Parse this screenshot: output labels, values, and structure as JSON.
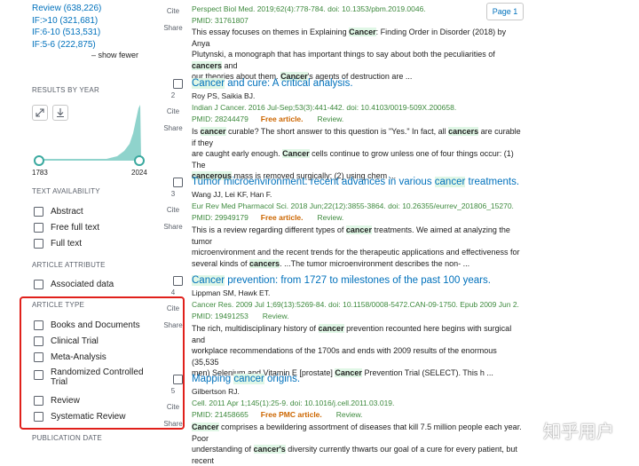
{
  "sidebar": {
    "top_links": [
      "Review (638,226)",
      "IF:>10 (321,681)",
      "IF:6-10 (513,531)",
      "IF:5-6 (222,875)"
    ],
    "show_fewer": "show fewer",
    "results_by_year": "RESULTS BY YEAR",
    "year_start": "1783",
    "year_end": "2024",
    "text_availability": {
      "heading": "TEXT AVAILABILITY",
      "items": [
        "Abstract",
        "Free full text",
        "Full text"
      ]
    },
    "article_attribute": {
      "heading": "ARTICLE ATTRIBUTE",
      "items": [
        "Associated data"
      ]
    },
    "article_type": {
      "heading": "ARTICLE TYPE",
      "items": [
        "Books and Documents",
        "Clinical Trial",
        "Meta-Analysis",
        "Randomized Controlled",
        "Trial",
        "Review",
        "Systematic Review"
      ]
    },
    "publication_date": "PUBLICATION DATE"
  },
  "page_button": "Page 1",
  "actions": {
    "cite": "Cite",
    "share": "Share"
  },
  "results": [
    {
      "journal": "Perspect Biol Med. 2019;62(4):778-784. doi: 10.1353/pbm.2019.0046.",
      "pmid": "PMID: 31761807",
      "snippet": [
        "This essay focuses on themes in Explaining ",
        "Cancer",
        ": Finding Order in Disorder (2018) by Anya",
        "Plutynski, a monograph that has important things to say about both the peculiarities of ",
        "cancers",
        " and",
        "our theories about them. ",
        "Cancer",
        "'s agents of destruction are ..."
      ]
    },
    {
      "number": "2",
      "title": [
        "Cancer",
        " and cure: A critical analysis."
      ],
      "authors": "Roy PS, Saikia BJ.",
      "journal": "Indian J Cancer. 2016 Jul-Sep;53(3):441-442. doi: 10.4103/0019-509X.200658.",
      "pmid": "PMID: 28244479",
      "badge": "Free article.",
      "type": "Review.",
      "snippet": [
        "Is ",
        "cancer",
        " curable? The short answer to this question is \"Yes.\" In fact, all ",
        "cancers",
        " are curable if they",
        "are caught early enough. ",
        "Cancer",
        " cells continue to grow unless one of four things occur: (1) The",
        "cancerous",
        " mass is removed surgically; (2) using chem ..."
      ]
    },
    {
      "number": "3",
      "title": [
        "Tumor microenvironment: recent advances in various ",
        "cancer",
        " treatments."
      ],
      "authors": "Wang JJ, Lei KF, Han F.",
      "journal": "Eur Rev Med Pharmacol Sci. 2018 Jun;22(12):3855-3864. doi: 10.26355/eurrev_201806_15270.",
      "pmid": "PMID: 29949179",
      "badge": "Free article.",
      "type": "Review.",
      "snippet": [
        "This is a review regarding different types of ",
        "cancer",
        " treatments. We aimed at analyzing the tumor",
        "microenvironment and the recent trends for the therapeutic applications and effectiveness for",
        "several kinds of ",
        "cancers",
        ". ...The tumor microenvironment describes the non- ..."
      ]
    },
    {
      "number": "4",
      "title": [
        "Cancer",
        " prevention: from 1727 to milestones of the past 100 years."
      ],
      "authors": "Lippman SM, Hawk ET.",
      "journal": "Cancer Res. 2009 Jul 1;69(13):5269-84. doi: 10.1158/0008-5472.CAN-09-1750. Epub 2009 Jun 2.",
      "pmid": "PMID: 19491253",
      "type": "Review.",
      "snippet": [
        "The rich, multidisciplinary history of ",
        "cancer",
        " prevention recounted here begins with surgical and",
        "workplace recommendations of the 1700s and ends with 2009 results of the enormous (35,535",
        "men) Selenium and Vitamin E [prostate] ",
        "Cancer",
        " Prevention Trial (SELECT). This h ..."
      ]
    },
    {
      "number": "5",
      "title": [
        "Mapping ",
        "cancer",
        " origins."
      ],
      "authors": "Gilbertson RJ.",
      "journal": "Cell. 2011 Apr 1;145(1):25-9. doi: 10.1016/j.cell.2011.03.019.",
      "pmid": "PMID: 21458665",
      "badge": "Free PMC article.",
      "type": "Review.",
      "snippet": [
        "Cancer",
        " comprises a bewildering assortment of diseases that kill 7.5 million people each year. Poor",
        "understanding of ",
        "cancer's",
        " diversity currently thwarts our goal of a cure for every patient, but recent"
      ]
    }
  ],
  "watermark": "知乎用户",
  "colors": {
    "link": "#0071bc",
    "highlight": "#e0f7e6",
    "journal_green": "#3e8a3e",
    "badge_orange": "#cc6600",
    "annotation_red": "#e0201b",
    "histogram_teal": "#8fd3cc"
  }
}
